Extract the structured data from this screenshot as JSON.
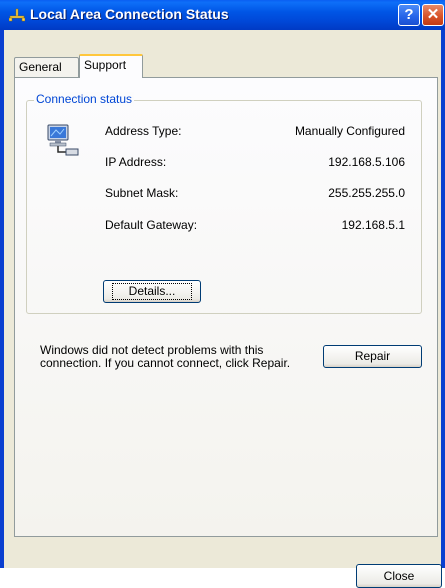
{
  "window": {
    "title": "Local Area Connection Status",
    "help_label": "?",
    "close_label": "✕"
  },
  "tabs": [
    {
      "label": "General"
    },
    {
      "label": "Support"
    }
  ],
  "connection_status": {
    "group_title": "Connection status",
    "rows": [
      {
        "label": "Address Type:",
        "value": "Manually Configured"
      },
      {
        "label": "IP Address:",
        "value": "192.168.5.106"
      },
      {
        "label": "Subnet Mask:",
        "value": "255.255.255.0"
      },
      {
        "label": "Default Gateway:",
        "value": "192.168.5.1"
      }
    ],
    "details_label": "Details..."
  },
  "repair": {
    "message": "Windows did not detect problems with this connection. If you cannot connect, click Repair.",
    "button_label": "Repair"
  },
  "footer": {
    "close_label": "Close"
  },
  "colors": {
    "title_bar": "#0055e5",
    "group_title": "#0046d5",
    "tab_highlight": "#ffc73c",
    "dialog_bg": "#ece9d8"
  }
}
